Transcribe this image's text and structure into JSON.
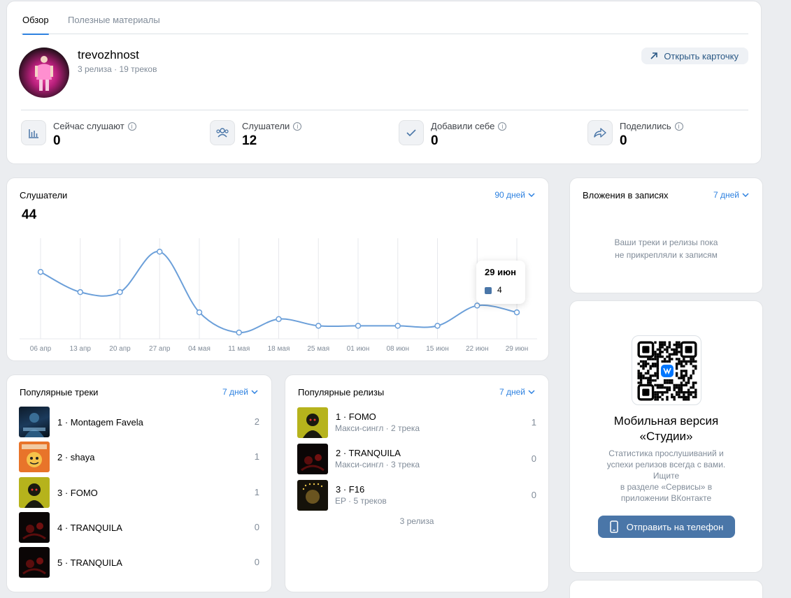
{
  "tabs": [
    {
      "label": "Обзор"
    },
    {
      "label": "Полезные материалы"
    }
  ],
  "artist": {
    "name": "trevozhnost",
    "subtitle": "3 релиза · 19 треков",
    "open_card_label": "Открыть карточку"
  },
  "stats": [
    {
      "label": "Сейчас слушают",
      "value": "0",
      "icon": "bars-chart-icon"
    },
    {
      "label": "Слушатели",
      "value": "12",
      "icon": "users-icon"
    },
    {
      "label": "Добавили себе",
      "value": "0",
      "icon": "check-icon"
    },
    {
      "label": "Поделились",
      "value": "0",
      "icon": "share-icon"
    }
  ],
  "listeners_chart": {
    "title": "Слушатели",
    "period": "90 дней",
    "total": "44",
    "tooltip": {
      "date": "29 июн",
      "value": "4"
    }
  },
  "chart_data": {
    "type": "line",
    "title": "Слушатели",
    "categories": [
      "06 апр",
      "13 апр",
      "20 апр",
      "27 апр",
      "04 мая",
      "11 мая",
      "18 мая",
      "25 мая",
      "01 июн",
      "08 июн",
      "15 июн",
      "22 июн",
      "29 июн"
    ],
    "values": [
      9,
      6,
      6,
      12,
      3,
      0,
      2,
      1,
      1,
      1,
      1,
      4,
      3
    ],
    "ylim": [
      0,
      14
    ],
    "grid": "vertical",
    "color": "#6b9fd9"
  },
  "attachments": {
    "title": "Вложения в записях",
    "period": "7 дней",
    "empty_line1": "Ваши треки и релизы пока",
    "empty_line2": "не прикрепляли к записям"
  },
  "mobile": {
    "title_line1": "Мобильная версия",
    "title_line2": "«Студии»",
    "desc_line1": "Статистика прослушиваний и",
    "desc_line2": "успехи релизов всегда с вами.",
    "desc_line3": "Ищите",
    "desc_line4": "в разделе «Сервисы» в",
    "desc_line5": "приложении ВКонтакте",
    "button_label": "Отправить на телефон"
  },
  "popular_tracks": {
    "title": "Популярные треки",
    "period": "7 дней",
    "items": [
      {
        "name": "1 · Montagem Favela",
        "count": "2"
      },
      {
        "name": "2 · shaya",
        "count": "1"
      },
      {
        "name": "3 · FOMO",
        "count": "1"
      },
      {
        "name": "4 · TRANQUILA",
        "count": "0"
      },
      {
        "name": "5 · TRANQUILA",
        "count": "0"
      }
    ]
  },
  "popular_releases": {
    "title": "Популярные релизы",
    "period": "7 дней",
    "items": [
      {
        "name": "1 · FOMO",
        "sub": "Макси-сингл · 2 трека",
        "count": "1"
      },
      {
        "name": "2 · TRANQUILA",
        "sub": "Макси-сингл · 3 трека",
        "count": "0"
      },
      {
        "name": "3 · F16",
        "sub": "EP · 5 треков",
        "count": "0"
      }
    ],
    "total_label": "3 релиза"
  },
  "colors": {
    "accent": "#2d81e0",
    "button": "#4a76a8",
    "background": "#ebedf0",
    "chart_line": "#6b9fd9"
  }
}
